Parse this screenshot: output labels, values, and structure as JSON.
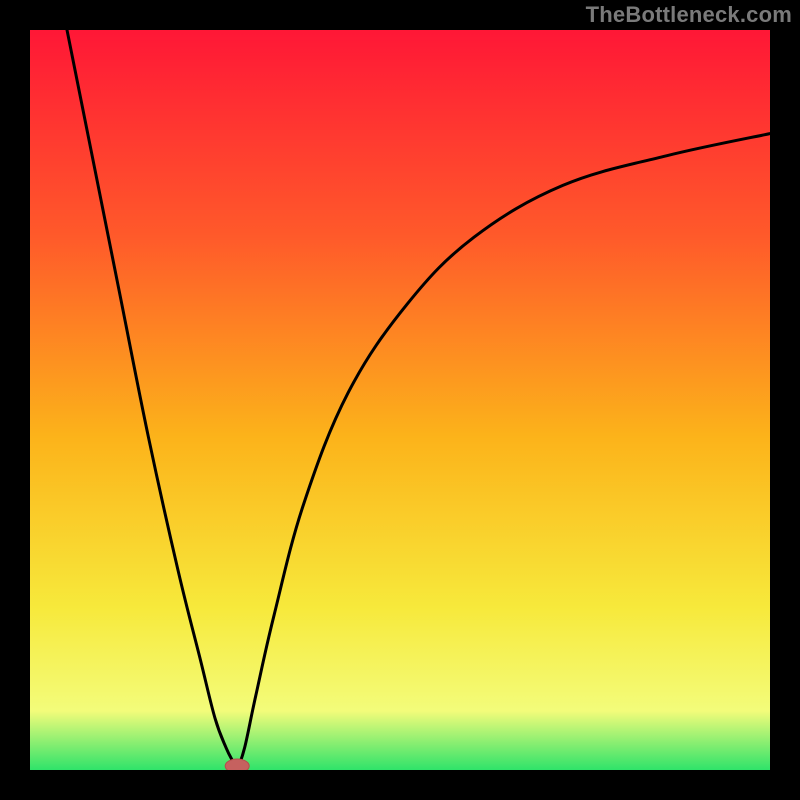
{
  "watermark": "TheBottleneck.com",
  "colors": {
    "bg": "#000000",
    "gradient_top": "#ff1736",
    "gradient_mid_upper": "#ff5a2a",
    "gradient_mid": "#fcb31a",
    "gradient_mid_lower": "#f7e93b",
    "gradient_lower": "#f3fc7a",
    "gradient_bottom": "#2fe36a",
    "curve": "#000000",
    "marker_fill": "#c6615f",
    "marker_stroke": "#b54e4c"
  },
  "chart_data": {
    "type": "line",
    "title": "",
    "xlabel": "",
    "ylabel": "",
    "xlim": [
      0,
      100
    ],
    "ylim": [
      0,
      100
    ],
    "x_optimum": 28,
    "curve_left": {
      "x": [
        5,
        8,
        12,
        16,
        20,
        23,
        25,
        26.5,
        27.5,
        28
      ],
      "y": [
        100,
        85,
        65,
        45,
        27,
        15,
        7,
        3,
        1,
        0
      ]
    },
    "curve_right": {
      "x": [
        28,
        29,
        30.5,
        33,
        37,
        43,
        51,
        60,
        72,
        86,
        100
      ],
      "y": [
        0,
        3,
        10,
        21,
        36,
        51,
        63,
        72,
        79,
        83,
        86
      ]
    },
    "marker": {
      "x": 28,
      "y": 0
    }
  }
}
